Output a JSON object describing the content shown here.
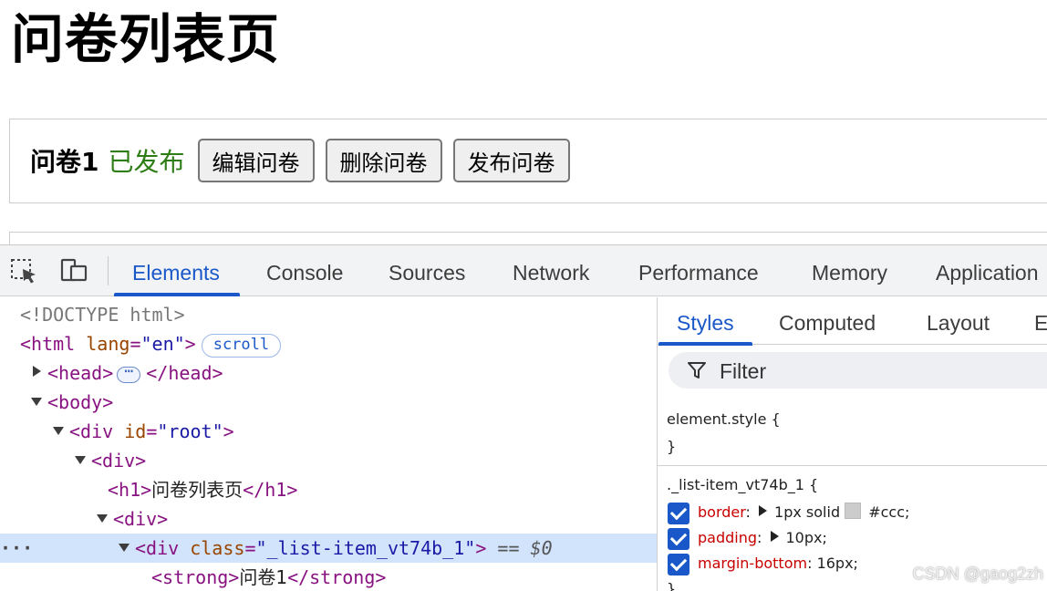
{
  "page": {
    "title": "问卷列表页",
    "item": {
      "name": "问卷1",
      "status": "已发布",
      "status_color": "#2e7d14",
      "buttons": [
        "编辑问卷",
        "删除问卷",
        "发布问卷"
      ]
    }
  },
  "devtools": {
    "toolbar_icons": [
      "inspect-element-icon",
      "device-toggle-icon"
    ],
    "tabs": [
      "Elements",
      "Console",
      "Sources",
      "Network",
      "Performance",
      "Memory",
      "Application"
    ],
    "active_tab": "Elements",
    "accent_color": "#1a58c9",
    "dom": {
      "doctype": "<!DOCTYPE html>",
      "html_open": "<html",
      "html_attr": "lang",
      "html_attr_val": "\"en\"",
      "html_close": ">",
      "scroll_badge": "scroll",
      "head_open": "<head>",
      "head_ellipsis": "⋯",
      "head_close": "</head>",
      "body_open": "<body>",
      "div_root_open": "<div",
      "div_root_attr": "id",
      "div_root_val": "\"root\"",
      "div_root_close": ">",
      "div_open": "<div>",
      "h1_open": "<h1>",
      "h1_text": "问卷列表页",
      "h1_close": "</h1>",
      "div_inner_open": "<div>",
      "div_item_open": "<div",
      "div_item_attr": "class",
      "div_item_val": "\"_list-item_vt74b_1\"",
      "div_item_close": ">",
      "eq_text": "==",
      "eq_ref": "$0",
      "row_dots": "···",
      "strong_open": "<strong>",
      "strong_text": "问卷1",
      "strong_close": "</strong>"
    },
    "styles": {
      "sub_tabs": [
        "Styles",
        "Computed",
        "Layout",
        "E"
      ],
      "active_sub_tab": "Styles",
      "filter_label": "Filter",
      "element_style_open": "element.style {",
      "element_style_close": "}",
      "rule_selector": "._list-item_vt74b_1 {",
      "rule_close": "}",
      "declarations": [
        {
          "prop": "border",
          "colon": ":",
          "expandable": true,
          "value": "1px solid",
          "swatch": "#ccc",
          "value2": "#ccc;"
        },
        {
          "prop": "padding",
          "colon": ":",
          "expandable": true,
          "value": "10px;"
        },
        {
          "prop": "margin-bottom",
          "colon": ":",
          "expandable": false,
          "value": "16px;"
        }
      ]
    },
    "watermark": "CSDN @gaog2zh"
  }
}
